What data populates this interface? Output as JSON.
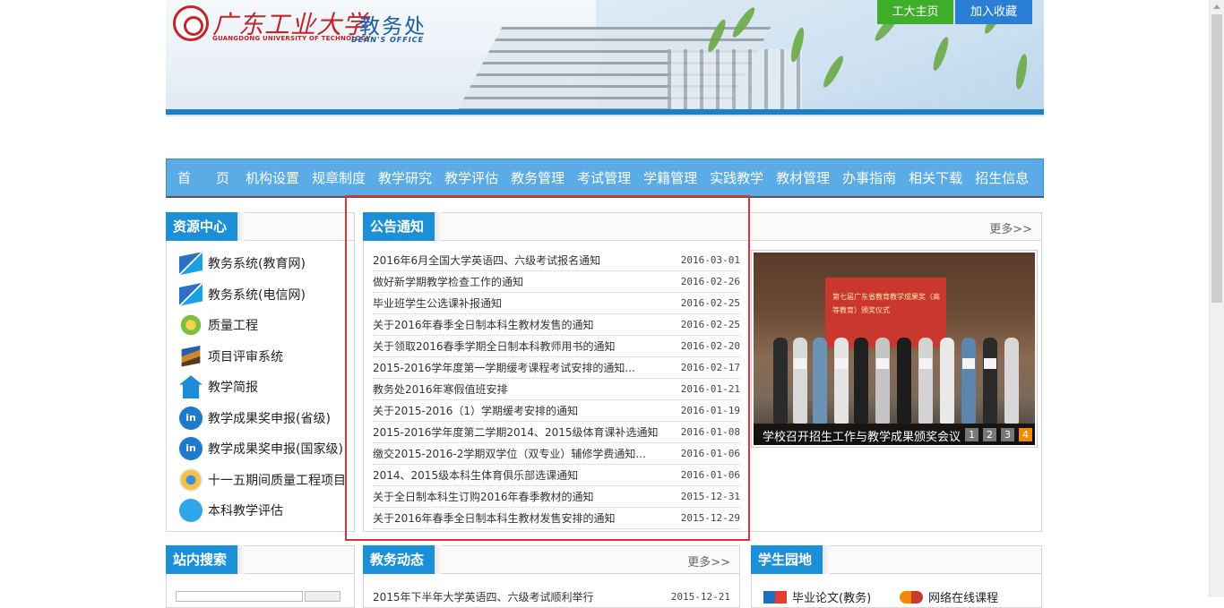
{
  "header": {
    "school_name_cn": "广东工业大学",
    "school_name_en": "GUANGDONG UNIVERSITY OF TECHNOLOGY",
    "office_cn": "教务处",
    "office_en": "DEAN'S OFFICE",
    "home_button": "工大主页",
    "favorite_button": "加入收藏"
  },
  "nav": {
    "items": [
      "首页",
      "机构设置",
      "规章制度",
      "教学研究",
      "教学评估",
      "教务管理",
      "考试管理",
      "学籍管理",
      "实践教学",
      "教材管理",
      "办事指南",
      "相关下载",
      "招生信息"
    ]
  },
  "resources": {
    "title": "资源中心",
    "items": [
      {
        "label": "教务系统(教育网)",
        "icon": "zf-icon"
      },
      {
        "label": "教务系统(电信网)",
        "icon": "zf-icon"
      },
      {
        "label": "质量工程",
        "icon": "gear-icon"
      },
      {
        "label": "项目评审系统",
        "icon": "book-icon"
      },
      {
        "label": "教学简报",
        "icon": "home-upload-icon"
      },
      {
        "label": "教学成果奖申报(省级)",
        "icon": "linkedin-icon"
      },
      {
        "label": "教学成果奖申报(国家级)",
        "icon": "linkedin-icon"
      },
      {
        "label": "十一五期间质量工程项目",
        "icon": "flower-icon"
      },
      {
        "label": "本科教学评估",
        "icon": "bird-icon"
      }
    ]
  },
  "notices": {
    "title": "公告通知",
    "more": "更多>>",
    "rows": [
      {
        "title": "2016年6月全国大学英语四、六级考试报名通知",
        "date": "2016-03-01"
      },
      {
        "title": "做好新学期教学检查工作的通知",
        "date": "2016-02-26"
      },
      {
        "title": "毕业班学生公选课补报通知",
        "date": "2016-02-25"
      },
      {
        "title": "关于2016年春季全日制本科生教材发售的通知",
        "date": "2016-02-25"
      },
      {
        "title": "关于领取2016春季学期全日制本科教师用书的通知",
        "date": "2016-02-20"
      },
      {
        "title": "2015-2016学年度第一学期缓考课程考试安排的通知...",
        "date": "2016-02-17"
      },
      {
        "title": "教务处2016年寒假值班安排",
        "date": "2016-01-21"
      },
      {
        "title": "关于2015-2016（1）学期缓考安排的通知",
        "date": "2016-01-19"
      },
      {
        "title": "2015-2016学年度第二学期2014、2015级体育课补选通知...",
        "date": "2016-01-08"
      },
      {
        "title": "缴交2015-2016-2学期双学位（双专业）辅修学费通知...",
        "date": "2016-01-06"
      },
      {
        "title": "2014、2015级本科生体育俱乐部选课通知",
        "date": "2016-01-06"
      },
      {
        "title": "关于全日制本科生订购2016年春季教材的通知",
        "date": "2015-12-31"
      },
      {
        "title": "关于2016年春季全日制本科生教材发售安排的通知",
        "date": "2015-12-29"
      }
    ]
  },
  "slideshow": {
    "board_text": "第七届广东省教育教学成果奖（高等教育）颁奖仪式",
    "caption": "学校召开招生工作与教学成果颁奖会议",
    "dots": [
      "1",
      "2",
      "3",
      "4"
    ],
    "active": "4"
  },
  "search": {
    "title": "站内搜索"
  },
  "news": {
    "title": "教务动态",
    "more": "更多>>",
    "first_row": {
      "title": "2015年下半年大学英语四、六级考试顺利举行",
      "date": "2015-12-21"
    }
  },
  "student": {
    "title": "学生园地",
    "links": [
      "毕业论文(教务)",
      "网络在线课程"
    ]
  },
  "colors": {
    "nav_bg": "#5aabe6",
    "panel_title_bg": "#1c8fd9",
    "home_button_bg": "#3fae2a",
    "favorite_button_bg": "#2a7fd4",
    "annotation_border": "#e0313b",
    "active_dot": "#f08a00"
  }
}
